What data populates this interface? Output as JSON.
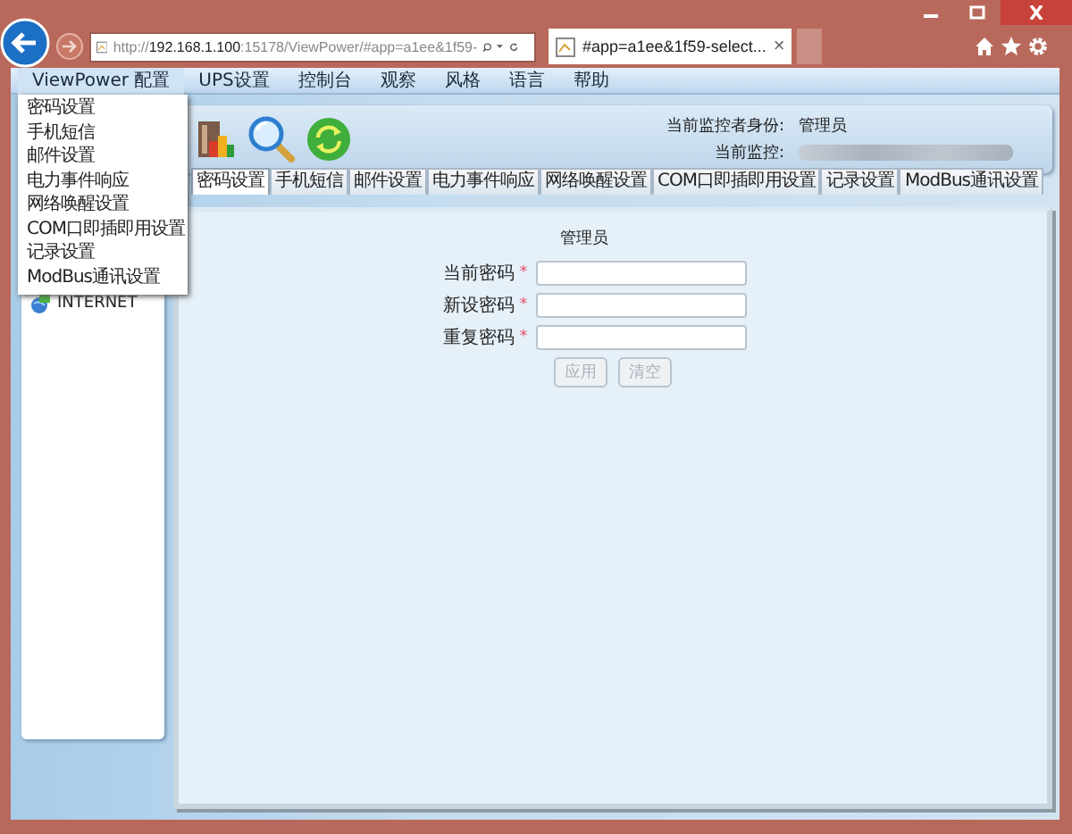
{
  "browser": {
    "address": "http://**192.168.1.100**:15178/ViewPower/#app=a1ee&1f59-",
    "tab": {
      "title": "#app=a1ee&1f59-select...",
      "close": "×"
    }
  },
  "menu_bar": [
    {
      "label": "ViewPower 配置",
      "selected": true
    },
    {
      "label": "UPS设置",
      "selected": false
    },
    {
      "label": "控制台",
      "selected": false
    },
    {
      "label": "观察",
      "selected": false
    },
    {
      "label": "风格",
      "selected": false
    },
    {
      "label": "语言",
      "selected": false
    },
    {
      "label": "帮助",
      "selected": false
    }
  ],
  "dropdown": [
    "密码设置",
    "手机短信",
    "邮件设置",
    "电力事件响应",
    "网络唤醒设置",
    "COM口即插即用设置",
    "记录设置",
    "ModBus通讯设置"
  ],
  "tree": [
    {
      "label": "INTERNET"
    }
  ],
  "header": {
    "identity_label": "当前监控者身份:",
    "identity_value": "管理员",
    "monitor_label": "当前监控:"
  },
  "tabs": [
    {
      "label": "密码设置",
      "selected": true
    },
    {
      "label": "手机短信",
      "selected": false
    },
    {
      "label": "邮件设置",
      "selected": false
    },
    {
      "label": "电力事件响应",
      "selected": false
    },
    {
      "label": "网络唤醒设置",
      "selected": false
    },
    {
      "label": "COM口即插即用设置",
      "selected": false
    },
    {
      "label": "记录设置",
      "selected": false
    },
    {
      "label": "ModBus通讯设置",
      "selected": false
    }
  ],
  "form": {
    "title": "管理员",
    "fields": [
      {
        "label": "当前密码",
        "marker": "*"
      },
      {
        "label": "新设密码",
        "marker": "*"
      },
      {
        "label": "重复密码",
        "marker": "*"
      }
    ],
    "buttons": [
      {
        "label": "应用",
        "disabled": true
      },
      {
        "label": "清空",
        "disabled": true
      }
    ]
  }
}
